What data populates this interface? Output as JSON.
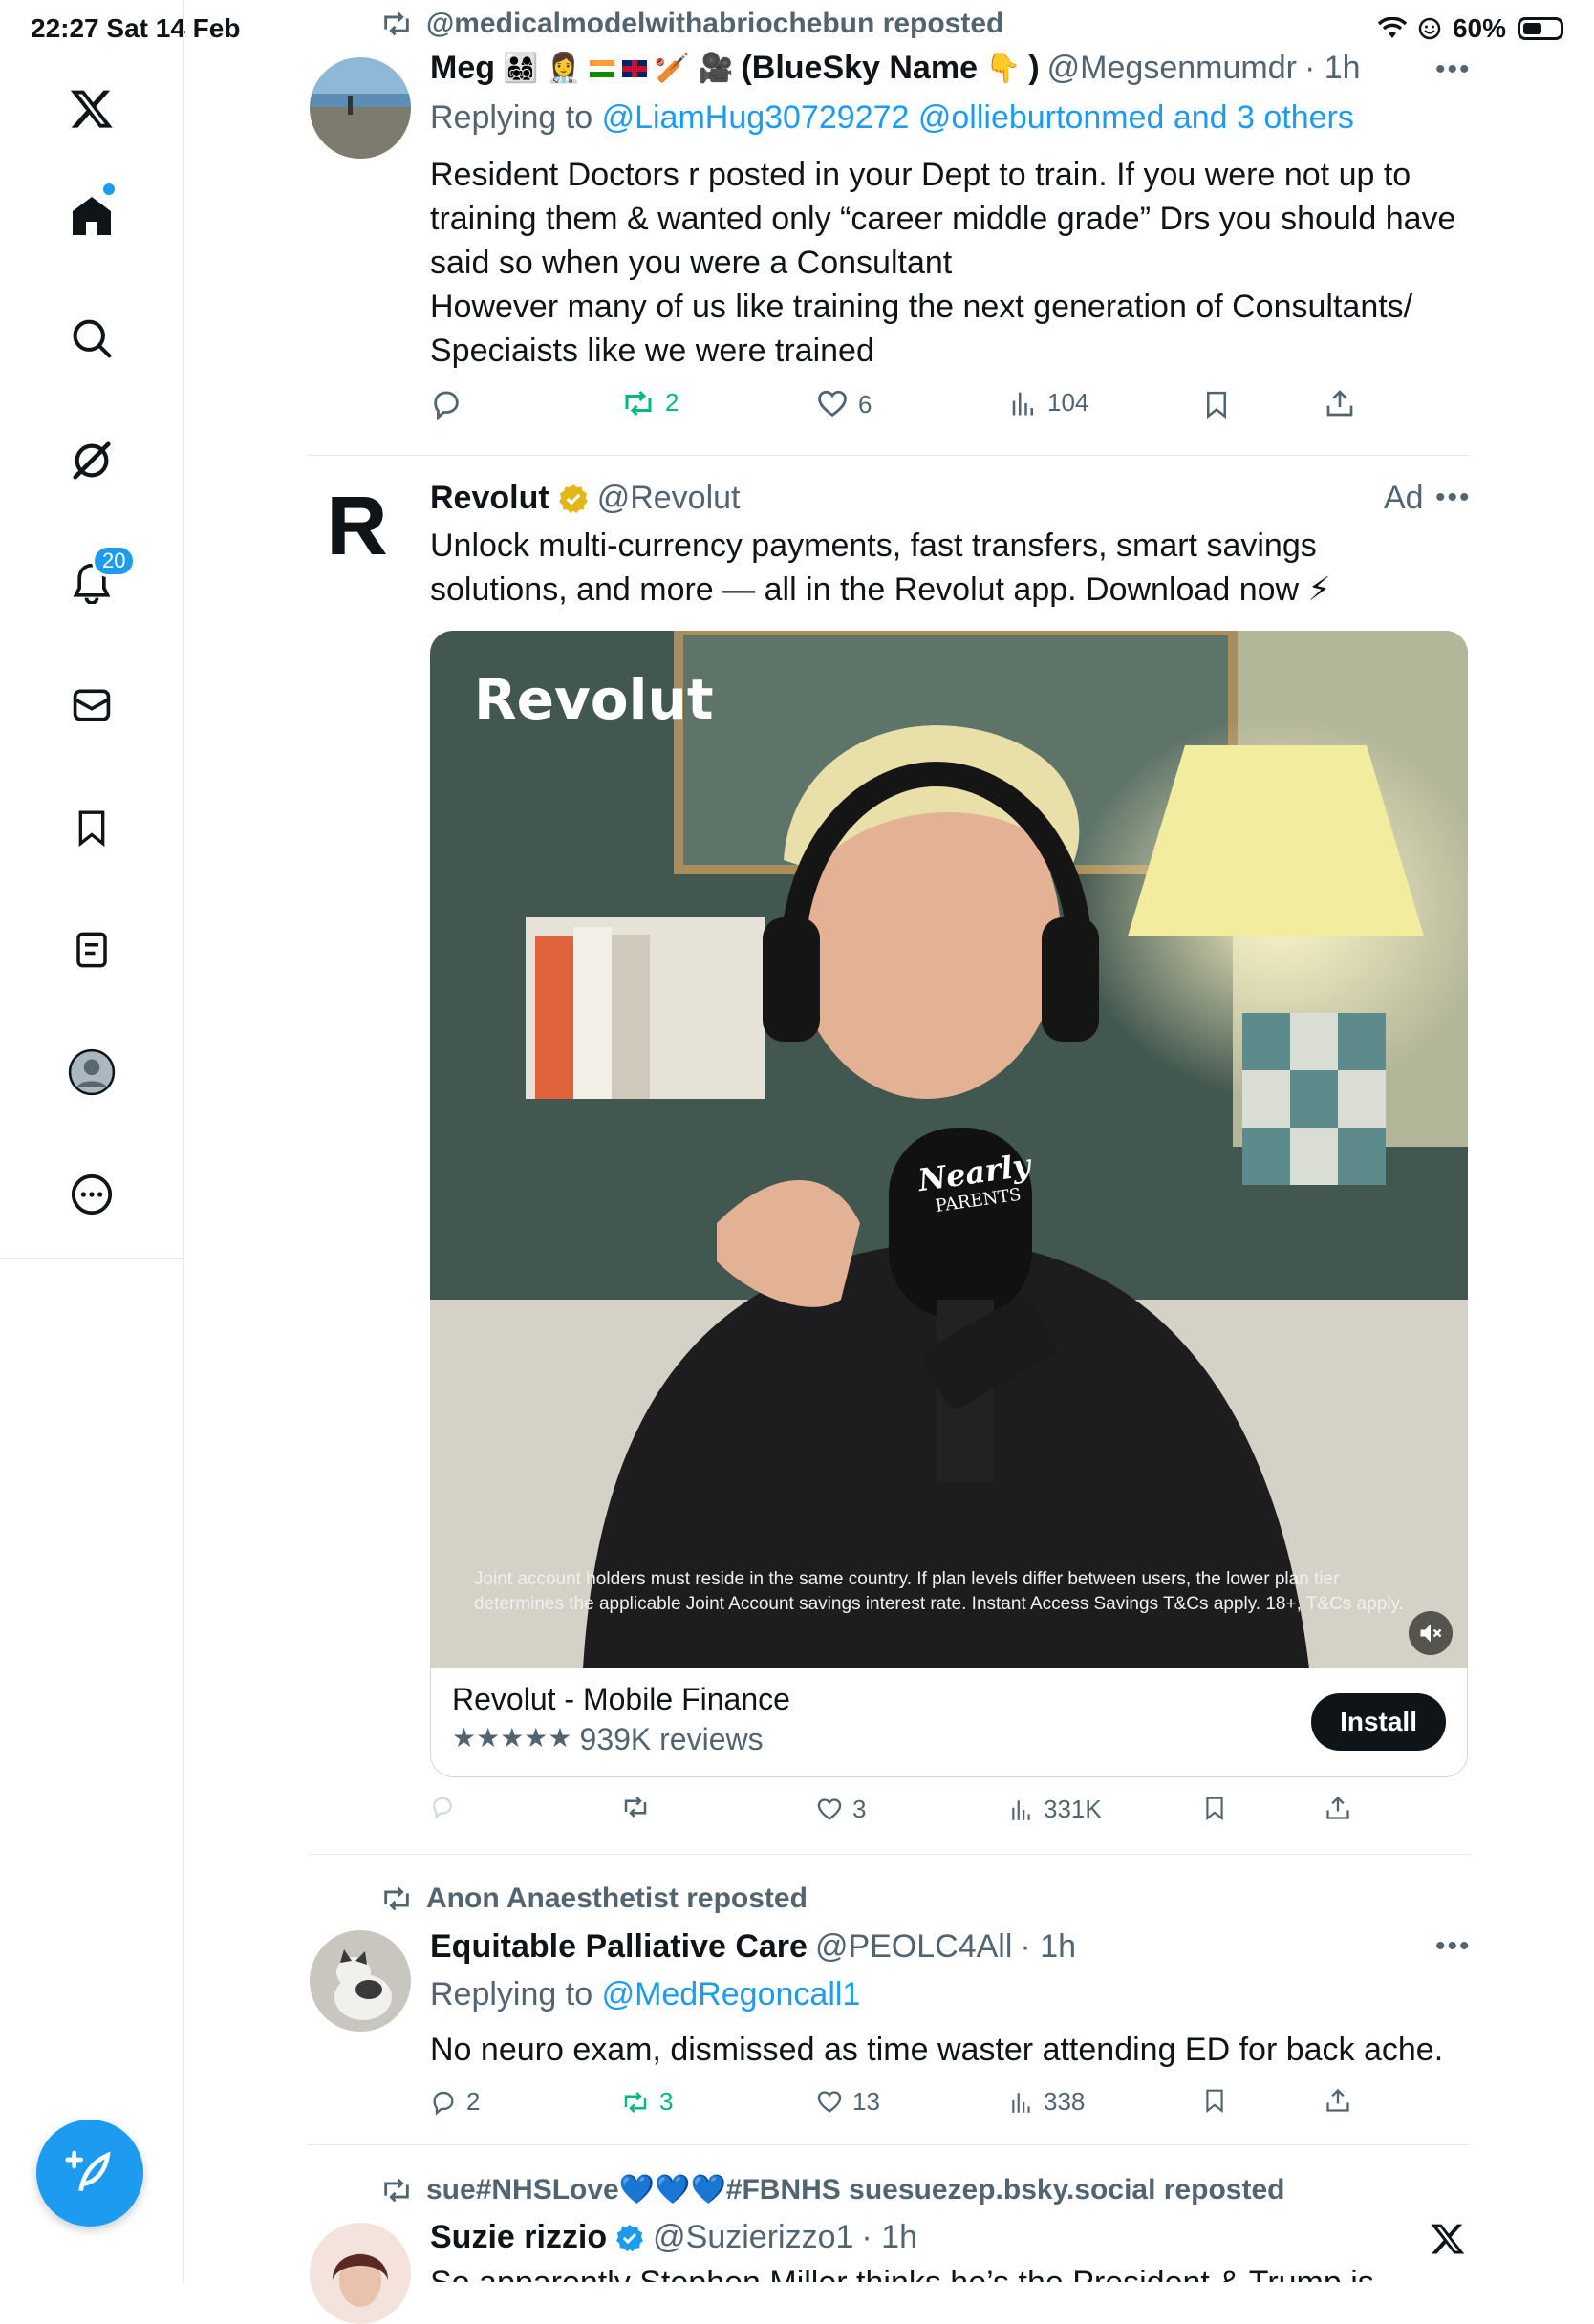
{
  "status": {
    "time_date": "22:27  Sat 14 Feb",
    "battery": "60%",
    "battery_level": 0.6
  },
  "sidebar": {
    "items": [
      {
        "icon": "x-logo-icon"
      },
      {
        "icon": "home-icon"
      },
      {
        "icon": "search-icon"
      },
      {
        "icon": "grok-icon"
      },
      {
        "icon": "notifications-icon",
        "badge": "20"
      },
      {
        "icon": "messages-icon"
      },
      {
        "icon": "bookmarks-icon"
      },
      {
        "icon": "lists-icon"
      },
      {
        "icon": "profile-icon"
      },
      {
        "icon": "more-icon"
      }
    ],
    "compose_icon": "compose-icon"
  },
  "tweets": [
    {
      "reposted_by": "@medicalmodelwithabriochebun reposted",
      "name": "Meg",
      "name_suffix": "(BlueSky Name",
      "name_close": ")",
      "handle": "@Megsenmumdr",
      "time": "· 1h",
      "replying_prefix": "Replying to",
      "replying_to": "@LiamHug30729272 @ollieburtonmed and 3 others",
      "text": "Resident Doctors r posted in your Dept to train. If you were not up to\ntraining them & wanted only “career middle grade” Drs you should have\nsaid so when you were a Consultant\nHowever many of us like training the next generation of Consultants/\nSpeciaists like we were trained",
      "replies": "",
      "reposts": "2",
      "likes": "6",
      "views": "104"
    },
    {
      "name": "Revolut",
      "handle": "@Revolut",
      "ad_label": "Ad",
      "text": "Unlock multi-currency payments, fast transfers, smart savings\nsolutions, and more — all in the Revolut app. Download now ⚡",
      "media": {
        "brand": "Revolut",
        "mic_brand": "Nearly",
        "mic_brand_sub": "PARENTS",
        "disclaimer_1": "Joint account holders must reside in the same country. If plan levels differ between users, the lower plan tier",
        "disclaimer_2": "determines the applicable Joint Account savings interest rate. Instant Access Savings T&Cs apply. 18+, T&Cs apply."
      },
      "card": {
        "title": "Revolut - Mobile Finance",
        "stars": "★★★★★",
        "reviews": "939K reviews",
        "install": "Install"
      },
      "replies": "",
      "reposts": "",
      "likes": "3",
      "views": "331K"
    },
    {
      "reposted_by": "Anon Anaesthetist reposted",
      "name": "Equitable Palliative Care",
      "handle": "@PEOLC4All",
      "time": "· 1h",
      "replying_prefix": "Replying to",
      "replying_to": "@MedRegoncall1",
      "text": "No neuro exam, dismissed as time waster attending ED for back ache.",
      "replies": "2",
      "reposts": "3",
      "likes": "13",
      "views": "338"
    },
    {
      "reposted_by": "sue#NHSLove💙💙💙#FBNHS suesuezep.bsky.social reposted",
      "name": "Suzie rizzio",
      "handle": "@Suzierizzo1",
      "time": "· 1h",
      "text": "So apparently Stephen Miller thinks he’s the President & Trump is"
    }
  ],
  "colors": {
    "accent": "#1d9bf0",
    "repost_green": "#00ba7c",
    "muted": "#536471",
    "verified_gold": "#e2b719"
  }
}
